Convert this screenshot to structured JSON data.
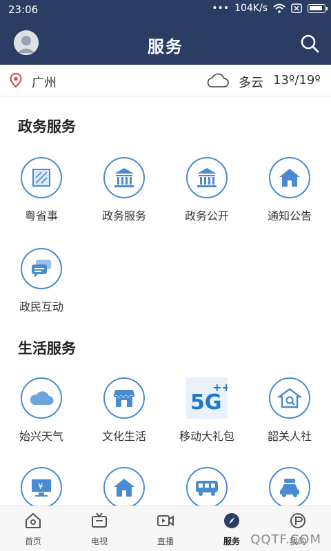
{
  "status_bar": {
    "time": "23:06",
    "dots": "•••",
    "speed": "104K/s"
  },
  "header": {
    "title": "服务"
  },
  "weather": {
    "city": "广州",
    "condition": "多云",
    "temp": "13º/19º"
  },
  "sections": [
    {
      "title": "政务服务",
      "items": [
        {
          "label": "粤省事",
          "icon": "document-icon"
        },
        {
          "label": "政务服务",
          "icon": "government-building-icon"
        },
        {
          "label": "政务公开",
          "icon": "government-building-icon"
        },
        {
          "label": "通知公告",
          "icon": "house-icon"
        },
        {
          "label": "政民互动",
          "icon": "chat-icon"
        }
      ]
    },
    {
      "title": "生活服务",
      "items": [
        {
          "label": "始兴天气",
          "icon": "cloud-icon"
        },
        {
          "label": "文化生活",
          "icon": "store-icon"
        },
        {
          "label": "移动大礼包",
          "icon": "5g-icon",
          "badge_text": "5G",
          "badge_sup": "++"
        },
        {
          "label": "韶关人社",
          "icon": "house-search-icon"
        },
        {
          "label": "",
          "icon": "computer-yen-icon"
        },
        {
          "label": "",
          "icon": "house-icon"
        },
        {
          "label": "",
          "icon": "bus-icon"
        },
        {
          "label": "",
          "icon": "car-icon"
        }
      ]
    }
  ],
  "tabs": [
    {
      "label": "首页",
      "icon": "home-icon",
      "active": false
    },
    {
      "label": "电视",
      "icon": "tv-icon",
      "active": false
    },
    {
      "label": "直播",
      "icon": "video-icon",
      "active": false
    },
    {
      "label": "服务",
      "icon": "compass-icon",
      "active": true
    },
    {
      "label": "我的",
      "icon": "profile-icon",
      "active": false
    }
  ],
  "watermark": "QQTF.COM",
  "colors": {
    "header_bg": "#2b3d63",
    "icon_blue": "#4a8bd0"
  }
}
